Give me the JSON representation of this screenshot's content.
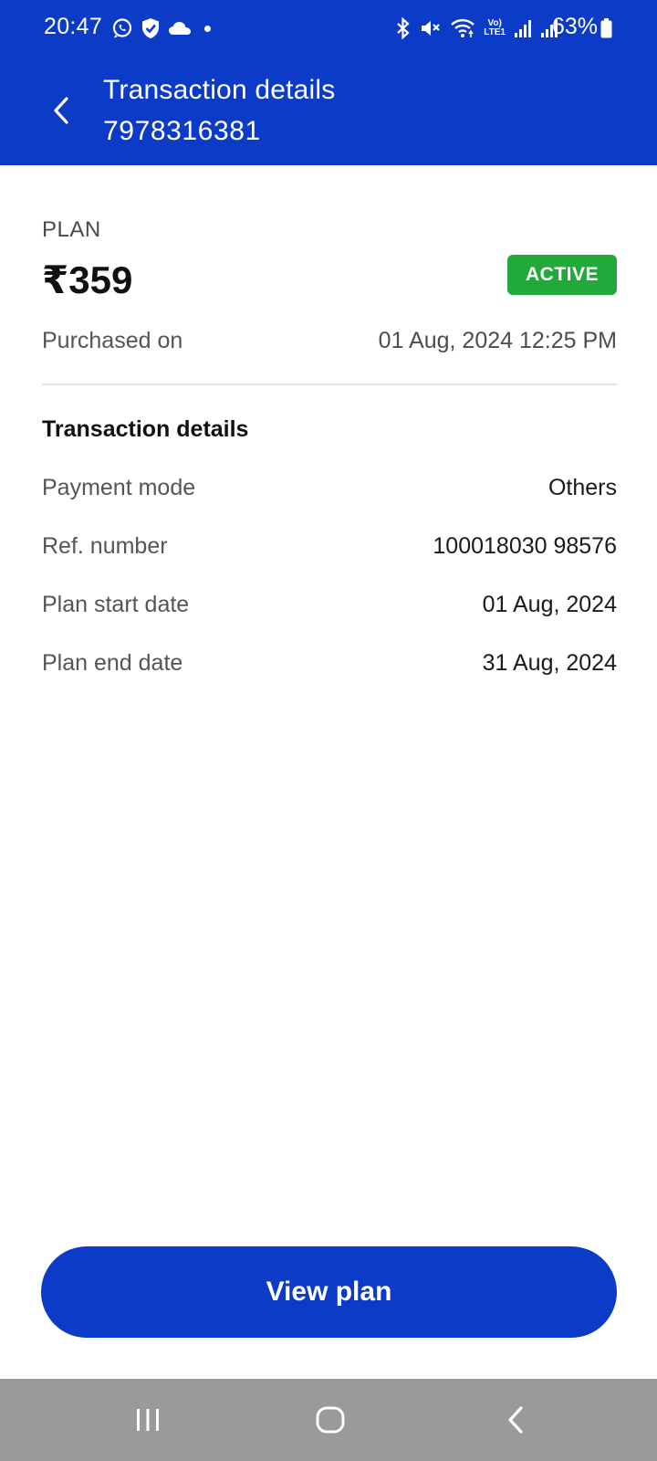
{
  "status_bar": {
    "time": "20:47",
    "left_icons": [
      "whatsapp-icon",
      "shield-check-icon",
      "cloud-icon",
      "dot-icon"
    ],
    "right_icons": [
      "bluetooth-icon",
      "mute-icon",
      "wifi-icon",
      "volte-icon",
      "signal-icon",
      "signal-icon"
    ],
    "volte_line1": "Vo)",
    "volte_line2": "LTE1",
    "battery": "63%"
  },
  "header": {
    "title": "Transaction details",
    "subtitle": "7978316381",
    "background": "#0c3cc7"
  },
  "plan": {
    "label": "PLAN",
    "price": "₹359",
    "status": "ACTIVE",
    "status_color": "#21a93a",
    "purchased_label": "Purchased on",
    "purchased_value": "01 Aug, 2024 12:25 PM"
  },
  "transaction": {
    "title": "Transaction details",
    "rows": [
      {
        "label": "Payment mode",
        "value": "Others"
      },
      {
        "label": "Ref. number",
        "value": "100018030 98576"
      },
      {
        "label": "Plan start date",
        "value": "01 Aug, 2024"
      },
      {
        "label": "Plan end date",
        "value": "31 Aug, 2024"
      }
    ]
  },
  "actions": {
    "view_plan": "View plan"
  },
  "nav_bar": {
    "buttons": [
      "recent-apps-icon",
      "home-icon",
      "back-icon"
    ]
  }
}
